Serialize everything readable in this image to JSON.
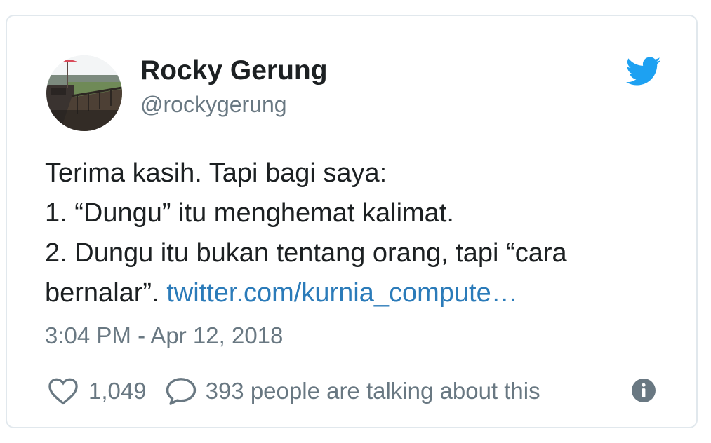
{
  "author": {
    "name": "Rocky Gerung",
    "handle": "@rockygerung"
  },
  "tweet": {
    "line1": "Terima kasih. Tapi bagi saya:",
    "line2": "1. “Dungu” itu menghemat kalimat.",
    "line3": "2. Dungu itu bukan tentang orang, tapi “cara",
    "line4_text": "bernalar”.",
    "link_text": "twitter.com/kurnia_compute…"
  },
  "timestamp": "3:04 PM - Apr 12, 2018",
  "actions": {
    "likes": "1,049",
    "talking": "393 people are talking about this"
  },
  "icons": {
    "brand": "twitter-bird-icon",
    "like": "heart-icon",
    "reply": "speech-bubble-icon",
    "info": "info-icon"
  },
  "colors": {
    "brand_blue": "#1da1f2",
    "link_blue": "#2b7bb9",
    "text_dark": "#1c2022",
    "text_muted": "#697882",
    "border": "#e1e8ed"
  }
}
